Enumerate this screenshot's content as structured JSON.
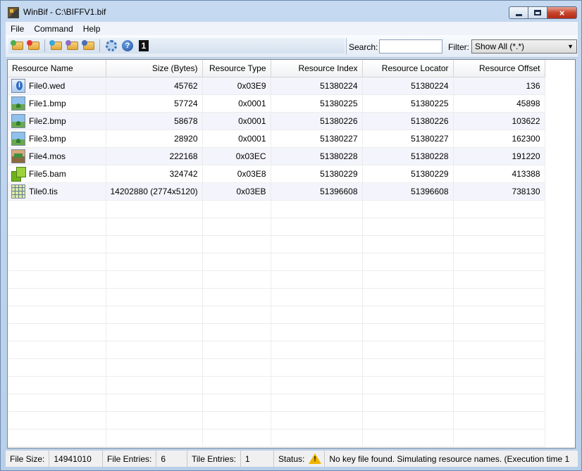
{
  "window": {
    "title": "WinBif - C:\\BIFFV1.bif",
    "minimize_label": "minimize",
    "maximize_label": "maximize",
    "close_label": "×"
  },
  "menu": [
    "File",
    "Command",
    "Help"
  ],
  "toolbar": {
    "buttons": [
      "open-icon",
      "close-file-icon",
      "add-icon",
      "extract-icon",
      "save-icon",
      "settings-icon",
      "help-icon",
      "one-icon"
    ],
    "search_label": "Search:",
    "search_value": "",
    "filter_label": "Filter:",
    "filter_value": "Show All (*.*)"
  },
  "table": {
    "columns": [
      "Resource Name",
      "Size (Bytes)",
      "Resource Type",
      "Resource Index",
      "Resource Locator",
      "Resource Offset"
    ],
    "rows": [
      {
        "icon": "wed-file-icon",
        "name": "File0.wed",
        "size": "45762",
        "type": "0x03E9",
        "index": "51380224",
        "locator": "51380224",
        "offset": "136"
      },
      {
        "icon": "bmp-file-icon",
        "name": "File1.bmp",
        "size": "57724",
        "type": "0x0001",
        "index": "51380225",
        "locator": "51380225",
        "offset": "45898"
      },
      {
        "icon": "bmp-file-icon",
        "name": "File2.bmp",
        "size": "58678",
        "type": "0x0001",
        "index": "51380226",
        "locator": "51380226",
        "offset": "103622"
      },
      {
        "icon": "bmp-file-icon",
        "name": "File3.bmp",
        "size": "28920",
        "type": "0x0001",
        "index": "51380227",
        "locator": "51380227",
        "offset": "162300"
      },
      {
        "icon": "mos-file-icon",
        "name": "File4.mos",
        "size": "222168",
        "type": "0x03EC",
        "index": "51380228",
        "locator": "51380228",
        "offset": "191220"
      },
      {
        "icon": "bam-file-icon",
        "name": "File5.bam",
        "size": "324742",
        "type": "0x03E8",
        "index": "51380229",
        "locator": "51380229",
        "offset": "413388"
      },
      {
        "icon": "tis-file-icon",
        "name": "Tile0.tis",
        "size": "14202880 (2774x5120)",
        "type": "0x03EB",
        "index": "51396608",
        "locator": "51396608",
        "offset": "738130"
      }
    ]
  },
  "status": {
    "file_size_label": "File Size:",
    "file_size_value": "14941010",
    "file_entries_label": "File Entries:",
    "file_entries_value": "6",
    "tile_entries_label": "Tile Entries:",
    "tile_entries_value": "1",
    "status_label": "Status:",
    "status_icon": "warning-icon",
    "status_message": "No key file found. Simulating resource names.  (Execution time 1"
  }
}
